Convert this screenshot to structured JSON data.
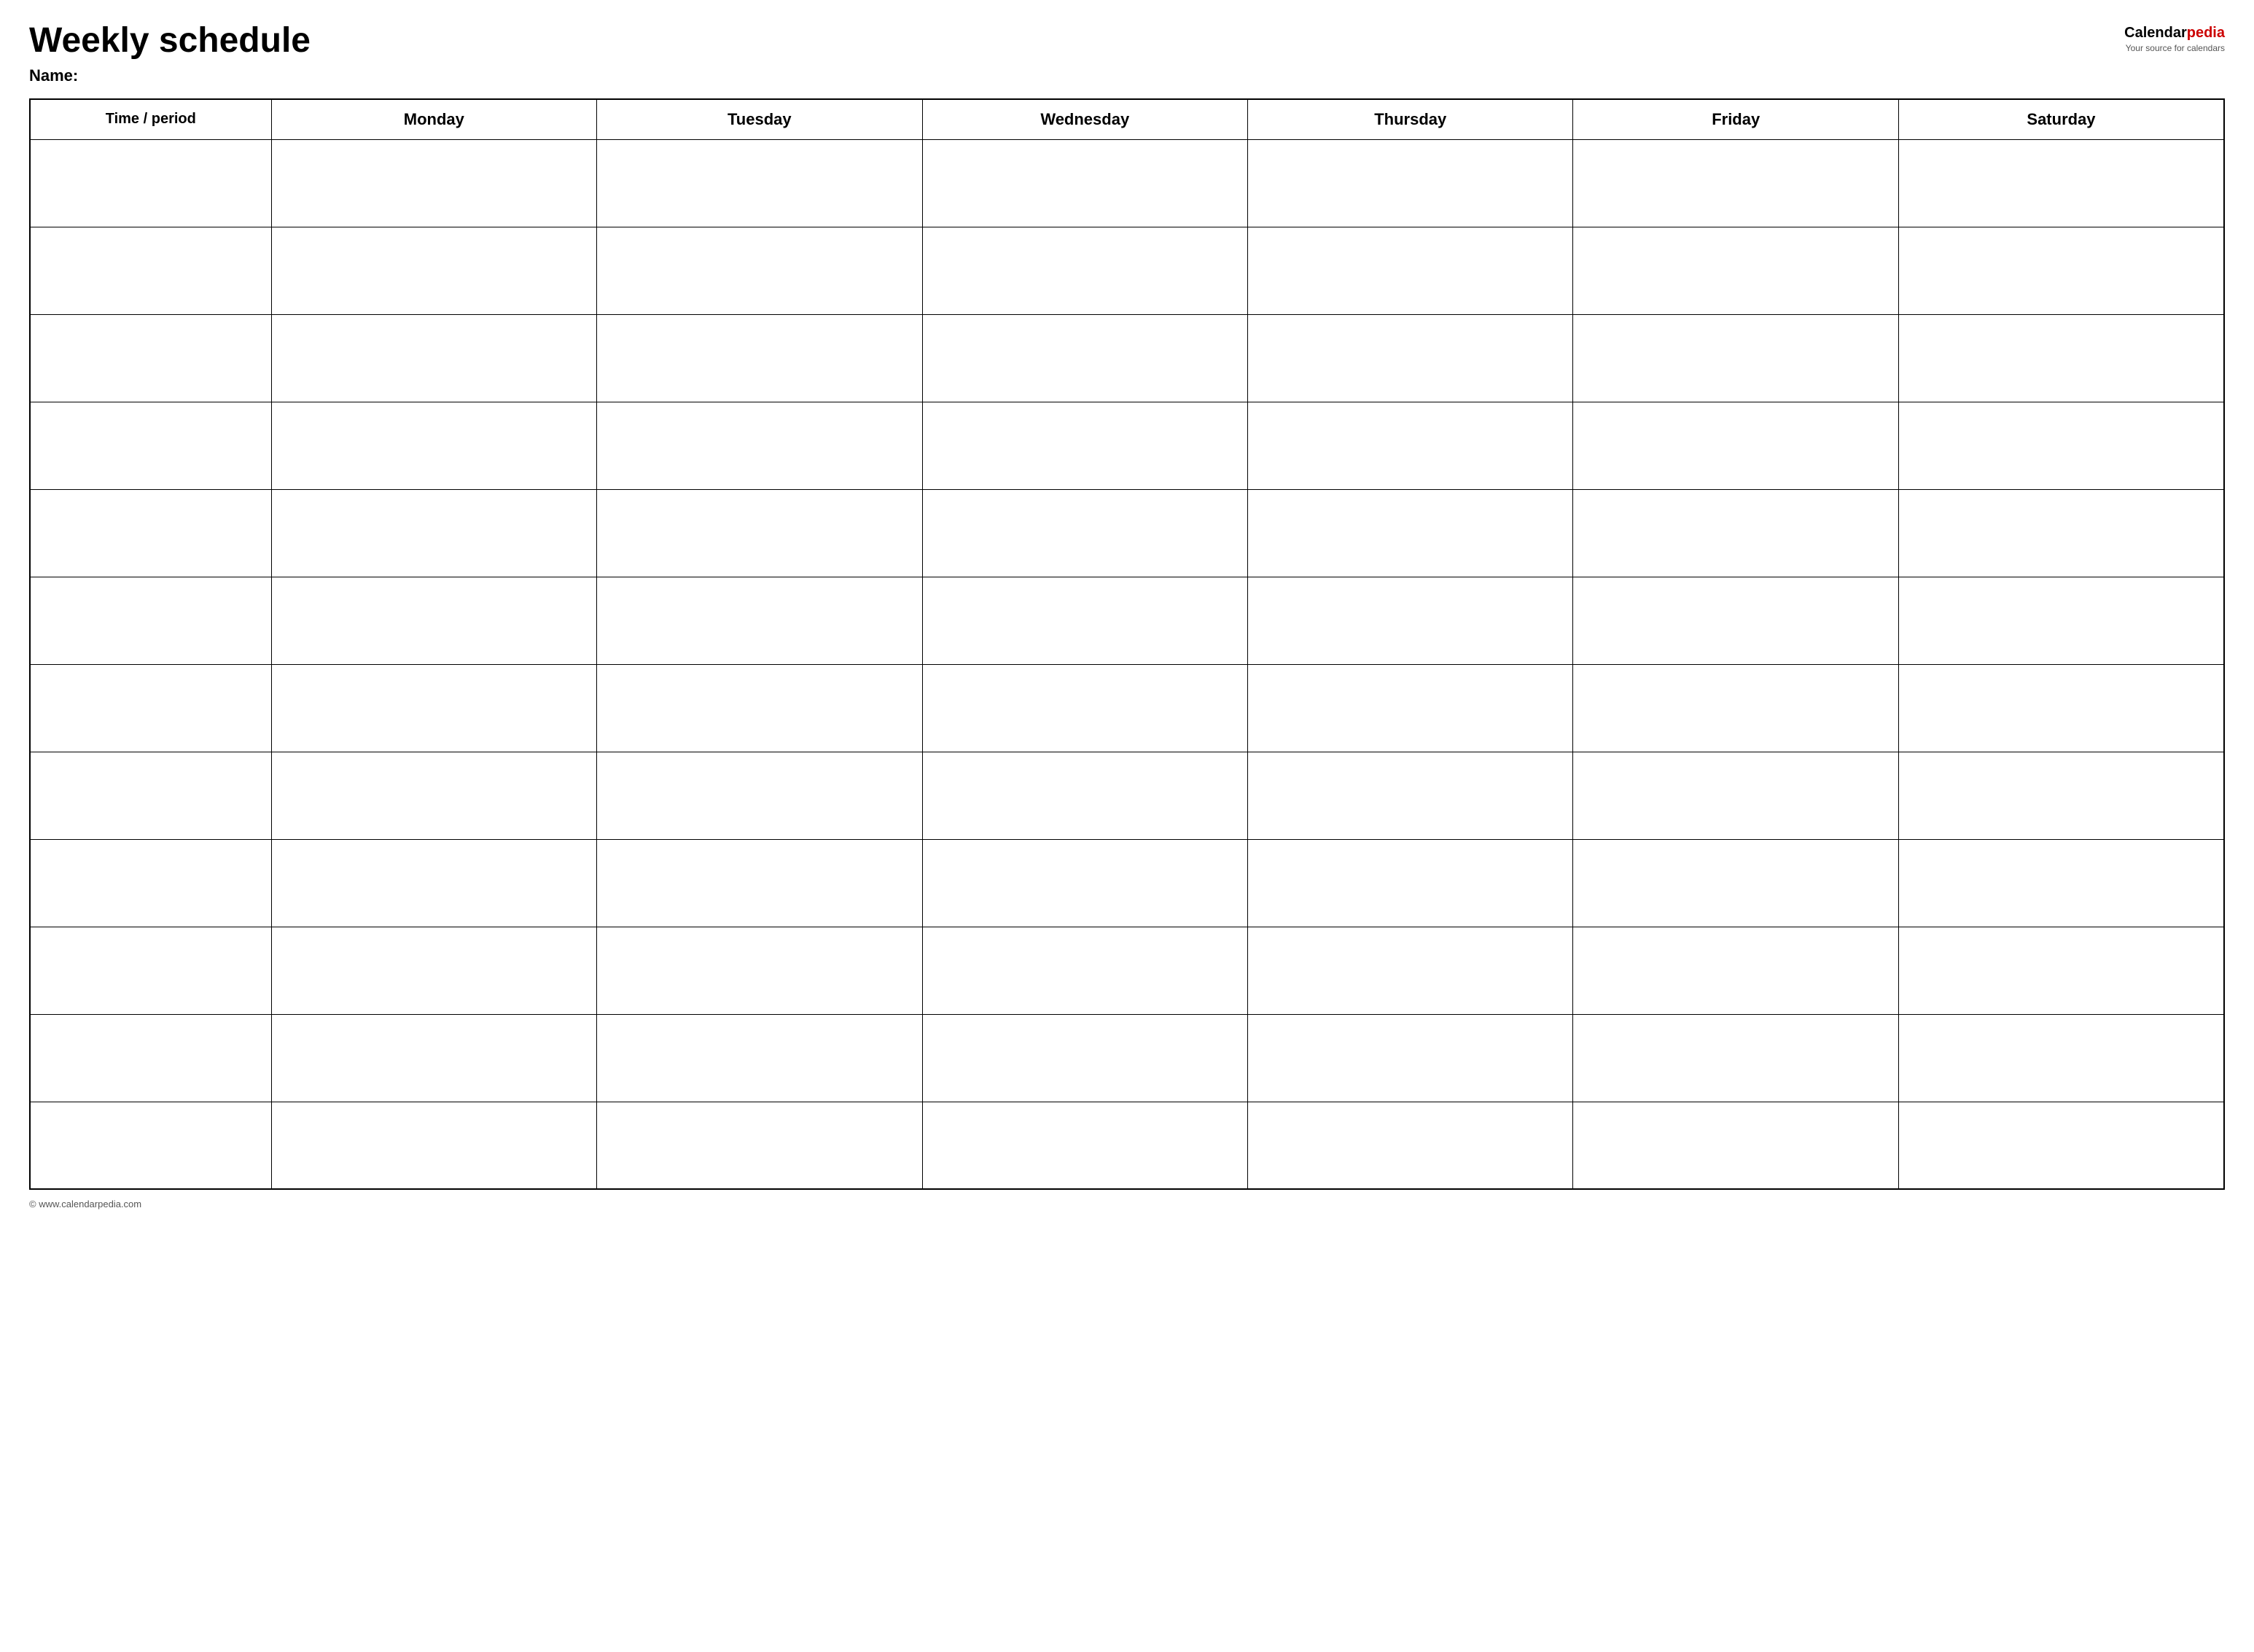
{
  "header": {
    "title": "Weekly schedule",
    "name_label": "Name:",
    "logo": {
      "calendar": "Calendar",
      "pedia": "pedia",
      "tagline": "Your source for calendars"
    }
  },
  "table": {
    "columns": [
      {
        "label": "Time / period",
        "key": "time"
      },
      {
        "label": "Monday",
        "key": "monday"
      },
      {
        "label": "Tuesday",
        "key": "tuesday"
      },
      {
        "label": "Wednesday",
        "key": "wednesday"
      },
      {
        "label": "Thursday",
        "key": "thursday"
      },
      {
        "label": "Friday",
        "key": "friday"
      },
      {
        "label": "Saturday",
        "key": "saturday"
      }
    ],
    "row_count": 12
  },
  "footer": {
    "url": "© www.calendarpedia.com"
  }
}
